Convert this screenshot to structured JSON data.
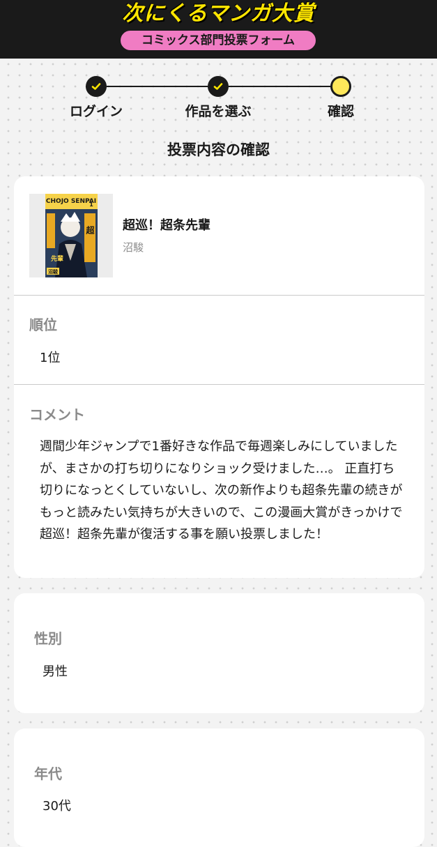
{
  "header": {
    "logo_text": "次にくるマンガ大賞",
    "subtitle": "コミックス部門投票フォーム",
    "colors": {
      "background": "#1a1a1a",
      "logo": "#ffe600",
      "pill": "#f07cc3"
    }
  },
  "stepper": {
    "steps": [
      {
        "label": "ログイン",
        "state": "done",
        "icon": "check-icon"
      },
      {
        "label": "作品を選ぶ",
        "state": "done",
        "icon": "check-icon"
      },
      {
        "label": "確認",
        "state": "current",
        "icon": ""
      }
    ],
    "colors": {
      "current": "#ffe85a",
      "done": "#1a1a1a"
    }
  },
  "page_title": "投票内容の確認",
  "selection": {
    "title": "超巡！超条先輩",
    "author": "沼駿",
    "cover": {
      "logo_text": "CHOJO SENPAI",
      "title_text": "超巡！超条先輩",
      "volume": "1"
    }
  },
  "rank": {
    "label": "順位",
    "value": "1位"
  },
  "comment": {
    "label": "コメント",
    "value": "週間少年ジャンプで1番好きな作品で毎週楽しみにしていましたが、まさかの打ち切りになりショック受けました…。 正直打ち切りになっとくしていないし、次の新作よりも超条先輩の続きがもっと読みたい気持ちが大きいので、この漫画大賞がきっかけで超巡！超条先輩が復活する事を願い投票しました！"
  },
  "gender": {
    "label": "性別",
    "value": "男性"
  },
  "age": {
    "label": "年代",
    "value": "30代"
  }
}
